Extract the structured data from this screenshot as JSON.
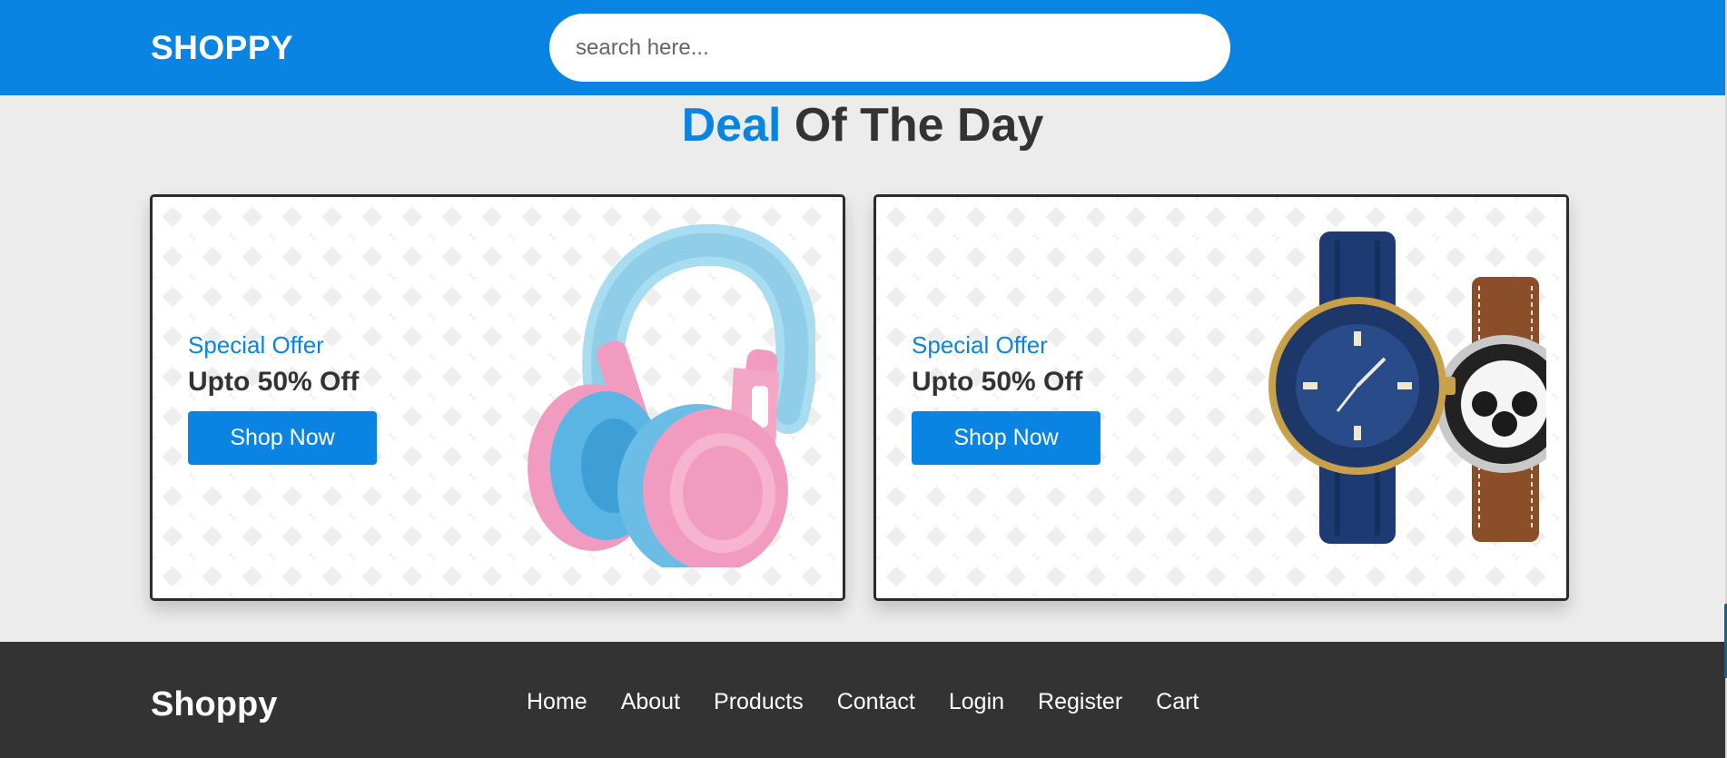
{
  "header": {
    "logo": "SHOPPY",
    "search_placeholder": "search here...",
    "brand_color": "#0a84e3"
  },
  "section": {
    "title_accent": "Deal",
    "title_rest": " Of The Day"
  },
  "deals": [
    {
      "offer_label": "Special Offer",
      "discount": "Upto 50% Off",
      "button_label": "Shop Now",
      "image": "pink-blue-headphones"
    },
    {
      "offer_label": "Special Offer",
      "discount": "Upto 50% Off",
      "button_label": "Shop Now",
      "image": "two-wristwatches"
    }
  ],
  "footer": {
    "logo": "Shoppy",
    "nav": [
      "Home",
      "About",
      "Products",
      "Contact",
      "Login",
      "Register",
      "Cart"
    ],
    "background": "#333333"
  }
}
